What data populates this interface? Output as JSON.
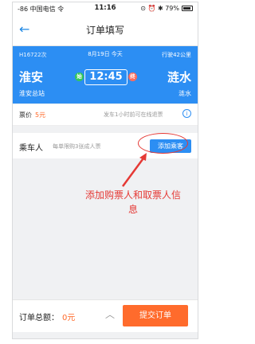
{
  "status": {
    "carrier": "-86 中国电信 令",
    "time": "11:16",
    "right_icons": "⊙ ⏰ ✱ 79%"
  },
  "nav": {
    "title": "订单填写",
    "back_glyph": "←"
  },
  "train": {
    "code": "H16722次",
    "date": "8月19日 今天",
    "duration": "行驶42公里",
    "from": "淮安",
    "to": "涟水",
    "depart_time": "12:45",
    "start_tag": "始",
    "end_tag": "终",
    "from_station": "淮安总站",
    "to_station": "涟水"
  },
  "fare": {
    "label": "票价",
    "value": "5元",
    "note": "发车1小时前可在线退票",
    "info_glyph": "i"
  },
  "passenger": {
    "label": "乘车人",
    "hint": "每单限购3张成人票",
    "add_button": "添加乘客"
  },
  "annotation": "添加购票人和取票人信息",
  "colors": {
    "primary": "#2c8ef3",
    "accent": "#ff6b2c",
    "annotation": "#e53935"
  },
  "footer": {
    "total_label": "订单总额：",
    "total_value": "0元",
    "expand_glyph": "︿",
    "submit": "提交订单"
  }
}
